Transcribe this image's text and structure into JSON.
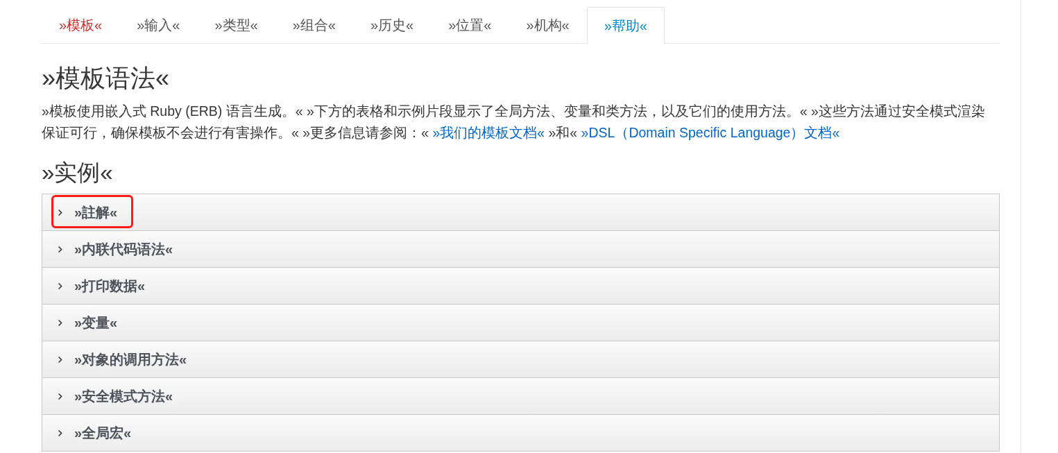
{
  "tabs": [
    {
      "label": "»模板«",
      "selected": false,
      "color": "#c9302c"
    },
    {
      "label": "»输入«",
      "selected": false,
      "color": "#555555"
    },
    {
      "label": "»类型«",
      "selected": false,
      "color": "#555555"
    },
    {
      "label": "»组合«",
      "selected": false,
      "color": "#555555"
    },
    {
      "label": "»历史«",
      "selected": false,
      "color": "#555555"
    },
    {
      "label": "»位置«",
      "selected": false,
      "color": "#555555"
    },
    {
      "label": "»机构«",
      "selected": false,
      "color": "#555555"
    },
    {
      "label": "»帮助«",
      "selected": true,
      "color": "#0088ce"
    }
  ],
  "title": "»模板语法«",
  "intro": [
    {
      "kind": "text",
      "text": "»模板使用嵌入式 Ruby (ERB) 语言生成。« »下方的表格和示例片段显示了全局方法、变量和类方法，以及它们的使用方法。« »这些方法通过安全模式渲染保证可行，确保模板不会进行有害操作。« »更多信息请参阅：« "
    },
    {
      "kind": "link",
      "text": "»我们的模板文档«"
    },
    {
      "kind": "text",
      "text": " »和« "
    },
    {
      "kind": "link",
      "text": "»DSL（Domain Specific Language）文档«"
    }
  ],
  "examples_heading": "»实例«",
  "examples": [
    {
      "label": "»註解«",
      "expanded": false,
      "highlighted": true
    },
    {
      "label": "»内联代码语法«",
      "expanded": false,
      "highlighted": false
    },
    {
      "label": "»打印数据«",
      "expanded": false,
      "highlighted": false
    },
    {
      "label": "»变量«",
      "expanded": false,
      "highlighted": false
    },
    {
      "label": "»对象的调用方法«",
      "expanded": false,
      "highlighted": false
    },
    {
      "label": "»安全模式方法«",
      "expanded": false,
      "highlighted": false
    },
    {
      "label": "»全局宏«",
      "expanded": false,
      "highlighted": false
    }
  ]
}
